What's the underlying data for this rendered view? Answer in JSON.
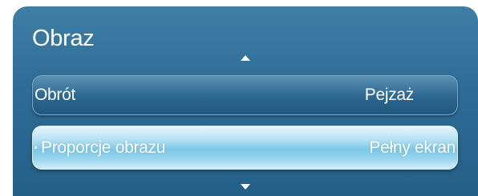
{
  "menu": {
    "title": "Obraz",
    "items": [
      {
        "label": "Obrót",
        "value": "Pejzaż",
        "selected": false
      },
      {
        "label": "Proporcje obrazu",
        "value": "Pełny ekran",
        "selected": true
      }
    ]
  },
  "icons": {
    "scroll_up": "triangle-up-icon",
    "scroll_down": "triangle-down-icon"
  },
  "colors": {
    "panel": "#2f6d96",
    "selected_row": "#7cc7e7",
    "text": "#ffffff"
  }
}
